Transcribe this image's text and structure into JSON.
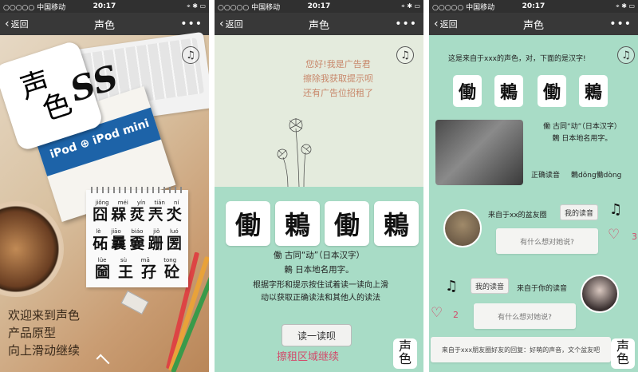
{
  "status_bar": {
    "carrier": "○○○○○ 中国移动",
    "time": "20:17",
    "right": "⌖ ✱ ▭"
  },
  "nav": {
    "back": "返回",
    "title": "声色",
    "more": "•••"
  },
  "icons": {
    "music": "music-note-icon",
    "back": "chevron-left-icon",
    "more": "more-dots-icon",
    "heart": "heart-icon"
  },
  "screen1": {
    "logo_chars": [
      "声",
      "色"
    ],
    "ss_mark": "SS",
    "book_text": "iPod ⊕ iPod mini",
    "notepad": [
      {
        "pinyin": [
          "jiǒng",
          "méi",
          "yín",
          "tiān",
          "ní"
        ],
        "chars": [
          "囧",
          "槑",
          "烎",
          "兲",
          "氼"
        ]
      },
      {
        "pinyin": [
          "lè",
          "jiāo",
          "biáo",
          "jiǒ",
          "luó"
        ],
        "chars": [
          "砳",
          "曩",
          "嫑",
          "跚",
          "圐"
        ]
      },
      {
        "pinyin": [
          "lüe",
          "sù",
          "mā",
          "tong"
        ],
        "chars": [
          "圙",
          "王",
          "孖",
          "砼"
        ]
      }
    ],
    "welcome": [
      "欢迎来到声色",
      "产品原型",
      "向上滑动继续"
    ]
  },
  "screen2": {
    "ad_lines": [
      "您好!我是广告君",
      "擦除我获取提示呗",
      "还有广告位招租了"
    ],
    "tiles": [
      "働",
      "鶇",
      "働",
      "鶇"
    ],
    "definitions": [
      "働 古同“动”（日本汉字）",
      "鶇 日本地名用字。"
    ],
    "instruction": "根据字形和提示按住试着读一读向上滑动以获取正确读法和其他人的读法",
    "read_button": "读一读呗",
    "rent_text": "擦租区域继续",
    "brand_chars": [
      "声",
      "色"
    ]
  },
  "screen3": {
    "intro": "这是来自于xxx的声色，对，下面的是汉字!",
    "tiles": [
      "働",
      "鶇",
      "働",
      "鶇"
    ],
    "definitions": [
      "働 古同“动”（日本汉字）",
      "鶇 日本地名用字。"
    ],
    "correct_label": "正确读音",
    "correct_value": "鶇dōng働dòng",
    "friend_from": "来自于xx的盆友圈",
    "my_voice": "我的读音",
    "comment_placeholder": "有什么想对她说?",
    "likes_1": "3",
    "your_voice": "我的读音",
    "from_you": "来自于你的读音",
    "likes_2": "2",
    "bottom_comment": "来自于xxx朋友圈好友的回复：好萌的声音，文个盆友吧",
    "brand_chars": [
      "声",
      "色"
    ]
  }
}
